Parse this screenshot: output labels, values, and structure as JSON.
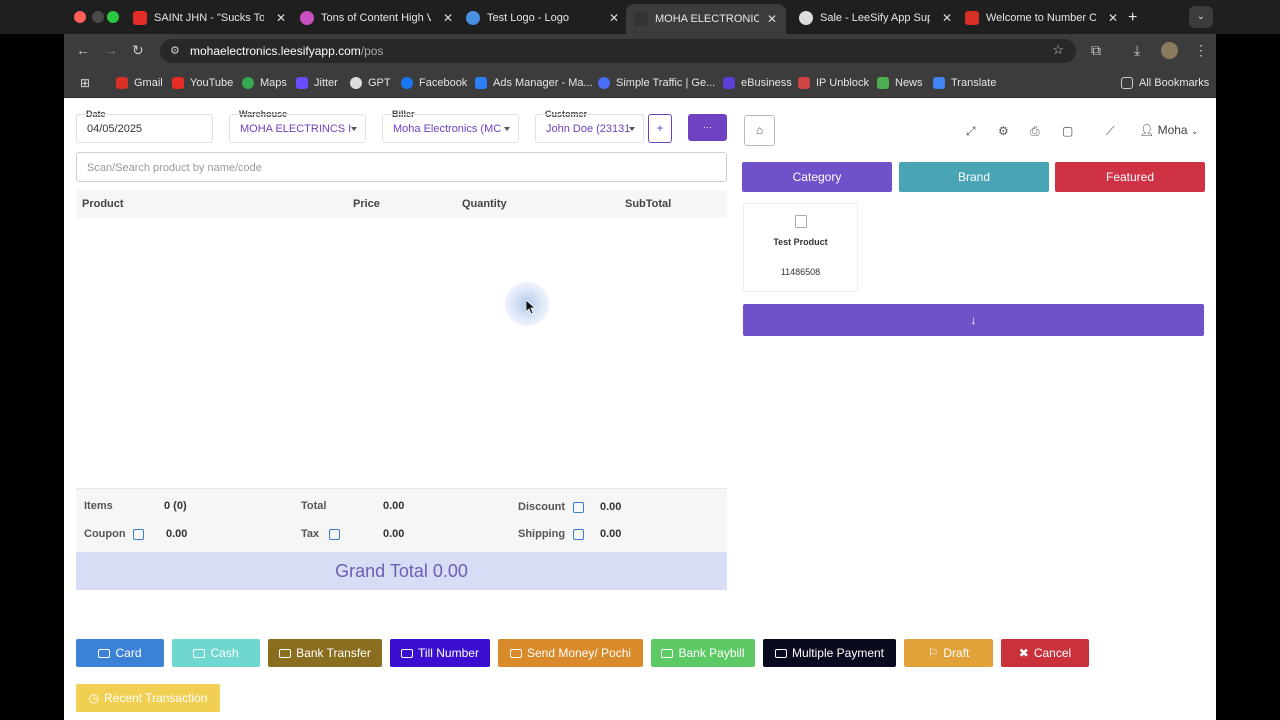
{
  "browser": {
    "tabs": [
      {
        "title": "SAINt JHN - \"Sucks To B",
        "fav_color": "#e52d27"
      },
      {
        "title": "Tons of Content High Vo",
        "fav_color": "#c850c0"
      },
      {
        "title": "Test Logo - Logo",
        "fav_color": "#4a90e2"
      },
      {
        "title": "MOHA ELECTRONICS LT",
        "fav_color": "#333333"
      },
      {
        "title": "Sale - LeeSify App Supp",
        "fav_color": "#dddddd"
      },
      {
        "title": "Welcome to Number On",
        "fav_color": "#d93025"
      }
    ],
    "url_host": "mohaelectronics.leesifyapp.com",
    "url_path": "/pos",
    "bookmarks": [
      "Gmail",
      "YouTube",
      "Maps",
      "Jitter",
      "GPT",
      "Facebook",
      "Ads Manager - Ma...",
      "Simple Traffic | Ge...",
      "eBusiness",
      "IP Unblock",
      "News",
      "Translate"
    ],
    "all_bookmarks": "All Bookmarks"
  },
  "pos": {
    "date_label": "Date",
    "date_value": "04/05/2025",
    "warehouse_label": "Warehouse",
    "warehouse_value": "MOHA ELECTRINCS I",
    "biller_label": "Biller",
    "biller_value": "Moha Electronics (MC",
    "customer_label": "Customer",
    "customer_value": "John Doe (23131",
    "add_label": "+",
    "more_label": "···",
    "search_placeholder": "Scan/Search product by name/code",
    "table_headers": {
      "product": "Product",
      "price": "Price",
      "quantity": "Quantity",
      "subtotal": "SubTotal"
    },
    "summary": {
      "items_label": "Items",
      "items_value": "0 (0)",
      "total_label": "Total",
      "total_value": "0.00",
      "discount_label": "Discount",
      "discount_value": "0.00",
      "coupon_label": "Coupon",
      "coupon_value": "0.00",
      "tax_label": "Tax",
      "tax_value": "0.00",
      "shipping_label": "Shipping",
      "shipping_value": "0.00"
    },
    "grand_total": "Grand Total 0.00",
    "payments": [
      {
        "label": "Card",
        "color": "#3b82d6"
      },
      {
        "label": "Cash",
        "color": "#6fd7d0"
      },
      {
        "label": "Bank Transfer",
        "color": "#8a6d1e"
      },
      {
        "label": "Till Number",
        "color": "#3a0fd0"
      },
      {
        "label": "Send Money/ Pochi",
        "color": "#d98a2b"
      },
      {
        "label": "Bank Paybill",
        "color": "#5cc964"
      },
      {
        "label": "Multiple Payment",
        "color": "#0a0a1e"
      },
      {
        "label": "Draft",
        "color": "#e2a23a"
      },
      {
        "label": "Cancel",
        "color": "#c9323b"
      }
    ],
    "recent_transaction": "Recent Transaction",
    "user_name": "Moha",
    "filters": {
      "category": "Category",
      "brand": "Brand",
      "featured": "Featured"
    },
    "product_name": "Test Product",
    "product_code": "11486508",
    "load_more": "↓"
  }
}
